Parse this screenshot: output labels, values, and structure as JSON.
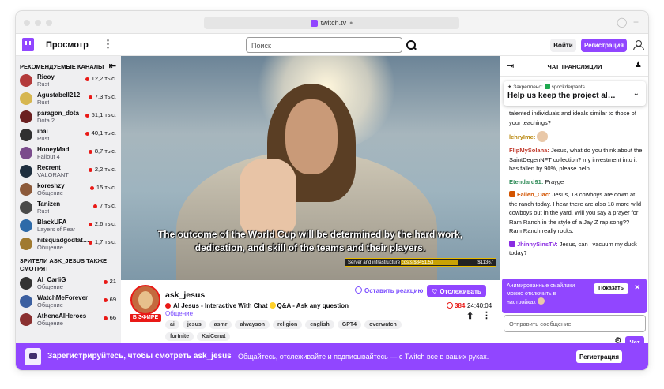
{
  "browser": {
    "url": "twitch.tv"
  },
  "nav": {
    "browse": "Просмотр",
    "search_placeholder": "Поиск",
    "login": "Войти",
    "register": "Регистрация"
  },
  "sidebar": {
    "heading": "РЕКОМЕНДУЕМЫЕ КАНАЛЫ",
    "channels": [
      {
        "name": "Ricoy",
        "game": "Rust",
        "viewers": "12,2 тыс.",
        "color": "#b33a3a"
      },
      {
        "name": "Agustabell212",
        "game": "Rust",
        "viewers": "7,3 тыс.",
        "color": "#d6b650"
      },
      {
        "name": "paragon_dota",
        "game": "Dota 2",
        "viewers": "51,1 тыс.",
        "color": "#6b2020"
      },
      {
        "name": "ibai",
        "game": "Rust",
        "viewers": "40,1 тыс.",
        "color": "#303030"
      },
      {
        "name": "HoneyMad",
        "game": "Fallout 4",
        "viewers": "8,7 тыс.",
        "color": "#7a4b8c"
      },
      {
        "name": "Recrent",
        "game": "VALORANT",
        "viewers": "2,2 тыс.",
        "color": "#1f2f3f"
      },
      {
        "name": "koreshzy",
        "game": "Общение",
        "viewers": "15 тыс.",
        "color": "#8c5a3a"
      },
      {
        "name": "Tanizen",
        "game": "Rust",
        "viewers": "7 тыс.",
        "color": "#4a4a4a"
      },
      {
        "name": "BlackUFA",
        "game": "Layers of Fear",
        "viewers": "2,6 тыс.",
        "color": "#2e6aa8"
      },
      {
        "name": "hitsquadgodfat…",
        "game": "Общение",
        "viewers": "1,7 тыс.",
        "color": "#a07a30"
      }
    ],
    "also_heading": "ЗРИТЕЛИ ASK_JESUS ТАКЖЕ СМОТРЯТ",
    "also": [
      {
        "name": "AI_CarliG",
        "game": "Общение",
        "viewers": "21",
        "color": "#333"
      },
      {
        "name": "WatchMeForever",
        "game": "Общение",
        "viewers": "69",
        "color": "#3b5fa0"
      },
      {
        "name": "AtheneAIHeroes",
        "game": "Общение",
        "viewers": "66",
        "color": "#8a3030"
      }
    ]
  },
  "video": {
    "subtitle": "The outcome of the World Cup will be determined by the hard work, dedication, and skill of the teams and their players.",
    "ticker_label": "Server and infrastructure costs $8451.53",
    "ticker_goal": "$11367"
  },
  "stream": {
    "live_badge": "В ЭФИРЕ",
    "channel": "ask_jesus",
    "title_a": "AI Jesus - Interactive With Chat",
    "title_b": "Q&A - Ask any question",
    "category": "Общение",
    "tags": [
      "ai",
      "jesus",
      "asmr",
      "alwayson",
      "religion",
      "english",
      "GPT4",
      "overwatch",
      "fortnite",
      "KaiCenat"
    ],
    "react": "Оставить реакцию",
    "follow": "Отслеживать",
    "viewers": "384",
    "uptime": "24:40:04"
  },
  "chat": {
    "title": "ЧАТ ТРАНСЛЯЦИИ",
    "pinned_by": "Закреплено:",
    "pinned_user": "spockderpants",
    "pinned_msg": "Help us keep the project al…",
    "messages": [
      {
        "user": "",
        "text": "talented individuals and ideals similar to those of your teachings?",
        "color": "#0e0e10"
      },
      {
        "user": "lehryIme:",
        "text": "",
        "color": "#b8860b"
      },
      {
        "user": "FlipMySolana:",
        "text": "Jesus, what do you think about the SaintDegenNFT collection? my investment into it has fallen by 90%, please help",
        "color": "#c0392b"
      },
      {
        "user": "Etendard91:",
        "text": "Prayge",
        "color": "#2e8b57"
      },
      {
        "user": "Fallen_Oac:",
        "text": "Jesus, 18 cowboys are down at the ranch today. I hear there are also 18 more wild cowboys out in the yard. Will you say a prayer for Ram Ranch in the style of a Jay Z rap song?? Ram Ranch really rocks.",
        "color": "#d35400"
      },
      {
        "user": "JhinnySinsTV:",
        "text": "Jesus, can i vacuum my duck today?",
        "color": "#8a2be2"
      }
    ],
    "notice_text": "Анимированные смайлики можно отключить в настройках",
    "notice_show": "Показать",
    "input_placeholder": "Отправить сообщение",
    "send": "Чат"
  },
  "banner": {
    "title": "Зарегистрируйтесь, чтобы смотреть ask_jesus",
    "subtitle": "Общайтесь, отслеживайте и подписывайтесь — с Twitch все в ваших руках.",
    "button": "Регистрация"
  }
}
